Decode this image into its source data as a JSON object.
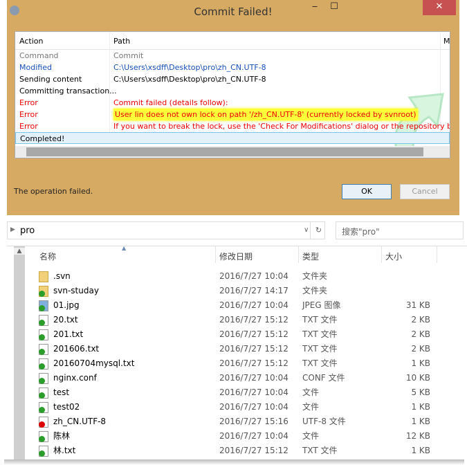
{
  "dialog": {
    "title": "Commit Failed!",
    "min": "‒",
    "max": "☐",
    "close": "✕",
    "columns": {
      "action": "Action",
      "path": "Path",
      "mime": "M"
    },
    "rows": [
      {
        "action": "Command",
        "path": "Commit",
        "style": "gray"
      },
      {
        "action": "Modified",
        "path": "C:\\Users\\xsdff\\Desktop\\pro\\zh_CN.UTF-8",
        "style": "blue"
      },
      {
        "action": "Sending content",
        "path": "C:\\Users\\xsdff\\Desktop\\pro\\zh_CN.UTF-8",
        "style": ""
      },
      {
        "action": "Committing transaction...",
        "path": "",
        "style": ""
      },
      {
        "action": "Error",
        "path": "Commit failed (details follow):",
        "style": "red"
      },
      {
        "action": "Error",
        "path": "User lin does not own lock on path '/zh_CN.UTF-8' (currently locked by svnroot)",
        "style": "red hl"
      },
      {
        "action": "Error",
        "path": "If you want to break the lock, use the 'Check For Modifications' dialog or the repository browser.",
        "style": "red"
      },
      {
        "action": "Completed!",
        "path": "",
        "style": "sel"
      }
    ],
    "status": "The operation failed.",
    "ok": "OK",
    "cancel": "Cancel"
  },
  "explorer": {
    "path": "pro",
    "search_placeholder": "搜索\"pro\"",
    "columns": {
      "name": "名称",
      "date": "修改日期",
      "type": "类型",
      "size": "大小"
    },
    "files": [
      {
        "name": ".svn",
        "date": "2016/7/27 10:04",
        "type": "文件夹",
        "size": "",
        "icon": "folder",
        "status": "none"
      },
      {
        "name": "svn-studay",
        "date": "2016/7/27 14:17",
        "type": "文件夹",
        "size": "",
        "icon": "folder",
        "status": "ok"
      },
      {
        "name": "01.jpg",
        "date": "2016/7/27 10:04",
        "type": "JPEG 图像",
        "size": "31 KB",
        "icon": "img",
        "status": "ok"
      },
      {
        "name": "20.txt",
        "date": "2016/7/27 15:12",
        "type": "TXT 文件",
        "size": "2 KB",
        "icon": "txt",
        "status": "ok"
      },
      {
        "name": "201.txt",
        "date": "2016/7/27 15:12",
        "type": "TXT 文件",
        "size": "2 KB",
        "icon": "txt",
        "status": "ok"
      },
      {
        "name": "201606.txt",
        "date": "2016/7/27 15:12",
        "type": "TXT 文件",
        "size": "2 KB",
        "icon": "txt",
        "status": "ok"
      },
      {
        "name": "20160704mysql.txt",
        "date": "2016/7/27 15:12",
        "type": "TXT 文件",
        "size": "1 KB",
        "icon": "txt",
        "status": "ok"
      },
      {
        "name": "nginx.conf",
        "date": "2016/7/27 10:04",
        "type": "CONF 文件",
        "size": "10 KB",
        "icon": "file",
        "status": "ok"
      },
      {
        "name": "test",
        "date": "2016/7/27 10:04",
        "type": "文件",
        "size": "5 KB",
        "icon": "file",
        "status": "ok"
      },
      {
        "name": "test02",
        "date": "2016/7/27 10:04",
        "type": "文件",
        "size": "1 KB",
        "icon": "file",
        "status": "ok"
      },
      {
        "name": "zh_CN.UTF-8",
        "date": "2016/7/27 15:16",
        "type": "UTF-8 文件",
        "size": "1 KB",
        "icon": "txt",
        "status": "conflict"
      },
      {
        "name": "陈林",
        "date": "2016/7/27 10:04",
        "type": "文件",
        "size": "12 KB",
        "icon": "file",
        "status": "ok"
      },
      {
        "name": "林.txt",
        "date": "2016/7/27 15:12",
        "type": "TXT 文件",
        "size": "1 KB",
        "icon": "txt",
        "status": "ok"
      }
    ]
  }
}
